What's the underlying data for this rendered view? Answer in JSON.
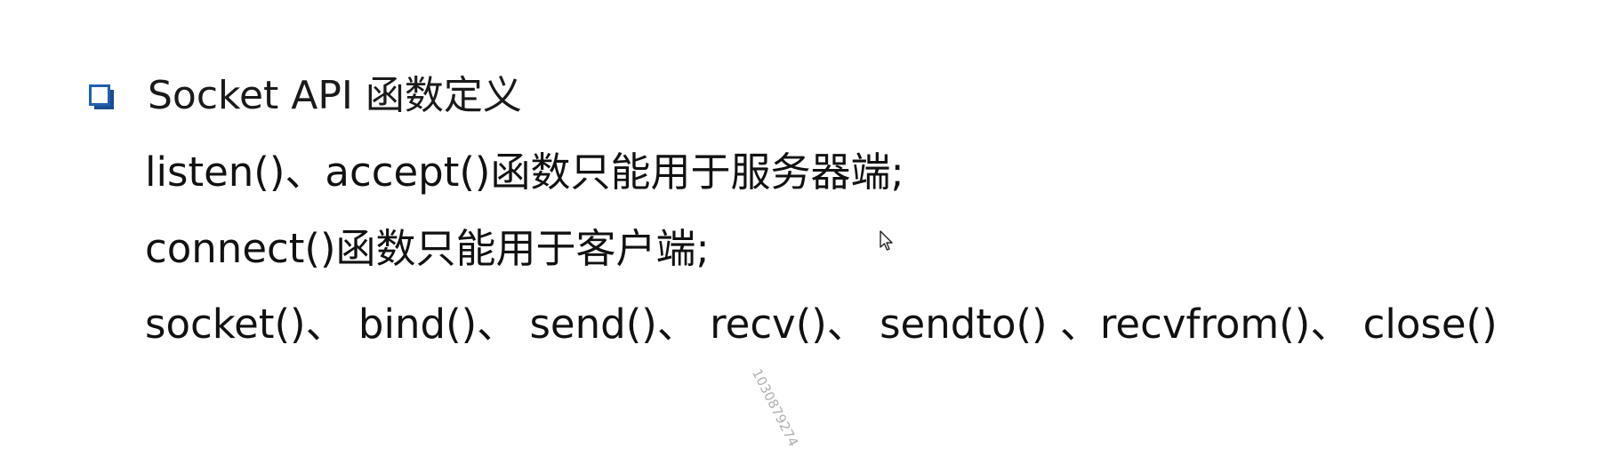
{
  "slide": {
    "heading": "Socket API 函数定义",
    "lines": [
      "listen()、accept()函数只能用于服务器端;",
      "connect()函数只能用于客户端;",
      "socket()、 bind()、 send()、 recv()、 sendto() 、recvfrom()、 close()"
    ],
    "watermark": "1030879274",
    "bullet_icon": "square-bullet-icon",
    "cursor_icon": "mouse-pointer-icon",
    "colors": {
      "bullet_border": "#1f5fb0",
      "bullet_shadow": "#1a4c8f",
      "text": "#111111",
      "watermark": "#b0b0b0"
    }
  }
}
